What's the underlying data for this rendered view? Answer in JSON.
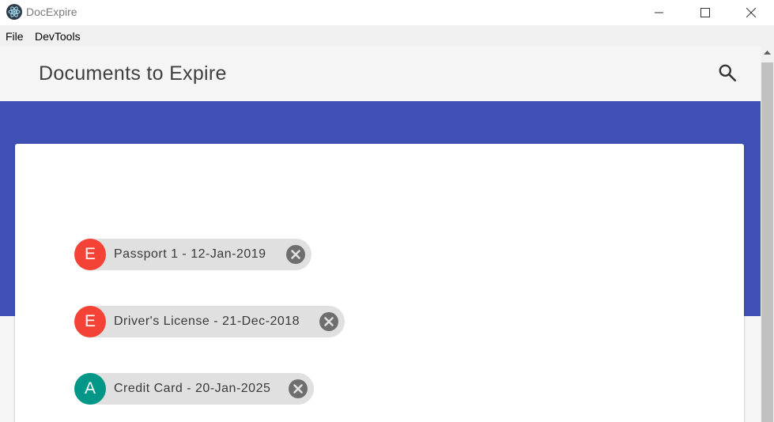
{
  "window": {
    "title": "DocExpire",
    "app_icon": "electron-atom-icon",
    "controls": [
      "minimize-icon",
      "maximize-icon",
      "close-icon"
    ]
  },
  "menu": {
    "file": "File",
    "devtools": "DevTools"
  },
  "header": {
    "title": "Documents to Expire",
    "search_icon": "search-icon"
  },
  "colors": {
    "primary": "#3f51b5",
    "expired_avatar": "#f44336",
    "active_avatar": "#009688",
    "chip_bg": "#e0e0e0",
    "delete_icon": "#6e6e6e"
  },
  "documents": [
    {
      "status_letter": "E",
      "label": "Passport 1 - 12-Jan-2019"
    },
    {
      "status_letter": "E",
      "label": "Driver's License - 21-Dec-2018"
    },
    {
      "status_letter": "A",
      "label": "Credit Card - 20-Jan-2025"
    }
  ]
}
